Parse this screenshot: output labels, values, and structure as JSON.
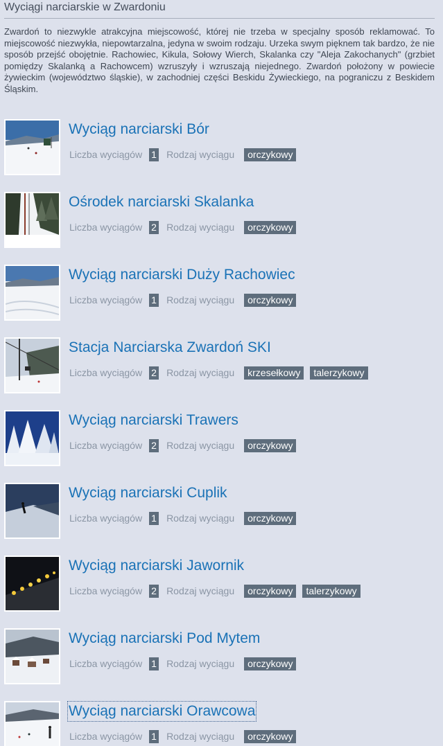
{
  "page": {
    "title": "Wyciągi narciarskie w Zwardoniu",
    "intro": "Zwardoń to niezwykle atrakcyjna miejscowość, której nie trzeba w specjalny sposób reklamować. To miejscowość niezwykła, niepowtarzalna, jedyna w swoim rodzaju. Urzeka swym pięknem tak bardzo, że nie sposób przejść obojętnie. Rachowiec, Kikula, Sołowy Wierch, Skalanka czy \"Aleja Zakochanych\" (grzbiet pomiędzy Skalanką a Rachowcem) wzruszyły i wzruszają niejednego. Zwardoń położony w powiecie żywieckim (województwo śląskie), w zachodniej części Beskidu Żywieckiego, na pograniczu z Beskidem Śląskim."
  },
  "labels": {
    "lift_count": "Liczba wyciągów",
    "lift_type": "Rodzaj wyciągu"
  },
  "lifts": [
    {
      "name": "Wyciąg narciarski Bór",
      "count": "1",
      "types": [
        "orczykowy"
      ],
      "photo": "snowy-slope"
    },
    {
      "name": "Ośrodek narciarski Skalanka",
      "count": "2",
      "types": [
        "orczykowy"
      ],
      "photo": "forest-lift"
    },
    {
      "name": "Wyciąg narciarski Duży Rachowiec",
      "count": "1",
      "types": [
        "orczykowy"
      ],
      "photo": "snowy-slope"
    },
    {
      "name": "Stacja Narciarska Zwardoń SKI",
      "count": "2",
      "types": [
        "krzesełkowy",
        "talerzykowy"
      ],
      "photo": "chairlift"
    },
    {
      "name": "Wyciąg narciarski Trawers",
      "count": "2",
      "types": [
        "orczykowy"
      ],
      "photo": "snowy-trees"
    },
    {
      "name": "Wyciąg narciarski Cuplik",
      "count": "1",
      "types": [
        "orczykowy"
      ],
      "photo": "skier-dusk"
    },
    {
      "name": "Wyciąg narciarski Jawornik",
      "count": "2",
      "types": [
        "orczykowy",
        "talerzykowy"
      ],
      "photo": "night-lights"
    },
    {
      "name": "Wyciąg narciarski Pod Mytem",
      "count": "1",
      "types": [
        "orczykowy"
      ],
      "photo": "village-winter"
    },
    {
      "name": "Wyciąg narciarski Orawcowa",
      "count": "1",
      "types": [
        "orczykowy"
      ],
      "photo": "skiers-slope"
    }
  ],
  "colors": {
    "background": "#dde1ec",
    "link": "#1a72b6",
    "badge": "#5e6d7c",
    "label": "#8a95a4"
  }
}
